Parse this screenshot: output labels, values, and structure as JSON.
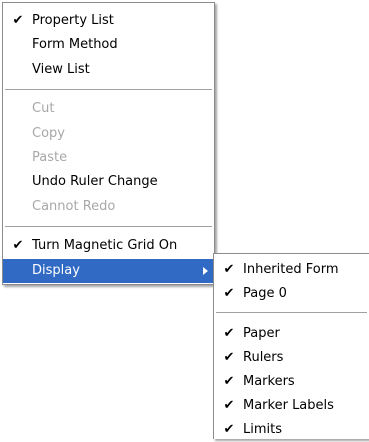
{
  "main_menu": {
    "items": [
      {
        "label": "Property List",
        "checked": true,
        "enabled": true
      },
      {
        "label": "Form Method",
        "checked": false,
        "enabled": true
      },
      {
        "label": "View List",
        "checked": false,
        "enabled": true
      },
      {
        "label": "Cut",
        "checked": false,
        "enabled": false
      },
      {
        "label": "Copy",
        "checked": false,
        "enabled": false
      },
      {
        "label": "Paste",
        "checked": false,
        "enabled": false
      },
      {
        "label": "Undo Ruler Change",
        "checked": false,
        "enabled": true
      },
      {
        "label": "Cannot Redo",
        "checked": false,
        "enabled": false
      },
      {
        "label": "Turn Magnetic Grid On",
        "checked": true,
        "enabled": true
      },
      {
        "label": "Display",
        "checked": false,
        "enabled": true,
        "highlighted": true,
        "has_submenu": true
      }
    ]
  },
  "sub_menu": {
    "items": [
      {
        "label": "Inherited Form",
        "checked": true
      },
      {
        "label": "Page 0",
        "checked": true
      },
      {
        "label": "Paper",
        "checked": true
      },
      {
        "label": "Rulers",
        "checked": true
      },
      {
        "label": "Markers",
        "checked": true
      },
      {
        "label": "Marker Labels",
        "checked": true
      },
      {
        "label": "Limits",
        "checked": true
      }
    ]
  },
  "check_glyph": "✔",
  "colors": {
    "highlight": "#316ac5",
    "disabled_text": "#a8a8a8",
    "border": "#8c8c8c"
  }
}
